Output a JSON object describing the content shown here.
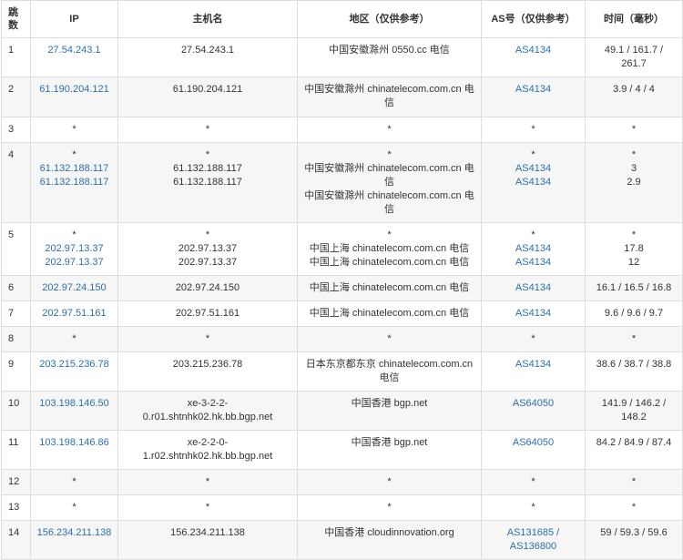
{
  "table": {
    "headers": {
      "hop": "跳数",
      "ip": "IP",
      "host": "主机名",
      "region": "地区（仅供参考）",
      "as": "AS号（仅供参考）",
      "time": "时间（毫秒）"
    },
    "rows": [
      {
        "hop": "1",
        "ip": [
          "27.54.243.1"
        ],
        "host": [
          "27.54.243.1"
        ],
        "region": [
          "中国安徽滁州 0550.cc 电信"
        ],
        "as": [
          "AS4134"
        ],
        "time": [
          "49.1 / 161.7 /",
          "261.7"
        ]
      },
      {
        "hop": "2",
        "ip": [
          "61.190.204.121"
        ],
        "host": [
          "61.190.204.121"
        ],
        "region": [
          "中国安徽滁州 chinatelecom.com.cn 电",
          "信"
        ],
        "as": [
          "AS4134"
        ],
        "time": [
          "3.9 / 4 / 4"
        ]
      },
      {
        "hop": "3",
        "ip": [
          "*"
        ],
        "host": [
          "*"
        ],
        "region": [
          "*"
        ],
        "as": [
          "*"
        ],
        "time": [
          "*"
        ]
      },
      {
        "hop": "4",
        "ip": [
          "*",
          "61.132.188.117",
          "61.132.188.117"
        ],
        "host": [
          "*",
          "61.132.188.117",
          "61.132.188.117"
        ],
        "region": [
          "*",
          "中国安徽滁州 chinatelecom.com.cn 电",
          "信",
          "中国安徽滁州 chinatelecom.com.cn 电",
          "信"
        ],
        "as": [
          "*",
          "AS4134",
          "AS4134"
        ],
        "time": [
          "*",
          "3",
          "2.9"
        ]
      },
      {
        "hop": "5",
        "ip": [
          "*",
          "202.97.13.37",
          "202.97.13.37"
        ],
        "host": [
          "*",
          "202.97.13.37",
          "202.97.13.37"
        ],
        "region": [
          "*",
          "中国上海 chinatelecom.com.cn 电信",
          "中国上海 chinatelecom.com.cn 电信"
        ],
        "as": [
          "*",
          "AS4134",
          "AS4134"
        ],
        "time": [
          "*",
          "17.8",
          "12"
        ]
      },
      {
        "hop": "6",
        "ip": [
          "202.97.24.150"
        ],
        "host": [
          "202.97.24.150"
        ],
        "region": [
          "中国上海 chinatelecom.com.cn 电信"
        ],
        "as": [
          "AS4134"
        ],
        "time": [
          "16.1 / 16.5 / 16.8"
        ]
      },
      {
        "hop": "7",
        "ip": [
          "202.97.51.161"
        ],
        "host": [
          "202.97.51.161"
        ],
        "region": [
          "中国上海 chinatelecom.com.cn 电信"
        ],
        "as": [
          "AS4134"
        ],
        "time": [
          "9.6 / 9.6 / 9.7"
        ]
      },
      {
        "hop": "8",
        "ip": [
          "*"
        ],
        "host": [
          "*"
        ],
        "region": [
          "*"
        ],
        "as": [
          "*"
        ],
        "time": [
          "*"
        ]
      },
      {
        "hop": "9",
        "ip": [
          "203.215.236.78"
        ],
        "host": [
          "203.215.236.78"
        ],
        "region": [
          "日本东京都东京 chinatelecom.com.cn",
          "电信"
        ],
        "as": [
          "AS4134"
        ],
        "time": [
          "38.6 / 38.7 / 38.8"
        ]
      },
      {
        "hop": "10",
        "ip": [
          "103.198.146.50"
        ],
        "host": [
          "xe-3-2-2-",
          "0.r01.shtnhk02.hk.bb.bgp.net"
        ],
        "region": [
          "中国香港 bgp.net"
        ],
        "as": [
          "AS64050"
        ],
        "time": [
          "141.9 / 146.2 /",
          "148.2"
        ]
      },
      {
        "hop": "11",
        "ip": [
          "103.198.146.86"
        ],
        "host": [
          "xe-2-2-0-",
          "1.r02.shtnhk02.hk.bb.bgp.net"
        ],
        "region": [
          "中国香港 bgp.net"
        ],
        "as": [
          "AS64050"
        ],
        "time": [
          "84.2 / 84.9 / 87.4"
        ]
      },
      {
        "hop": "12",
        "ip": [
          "*"
        ],
        "host": [
          "*"
        ],
        "region": [
          "*"
        ],
        "as": [
          "*"
        ],
        "time": [
          "*"
        ]
      },
      {
        "hop": "13",
        "ip": [
          "*"
        ],
        "host": [
          "*"
        ],
        "region": [
          "*"
        ],
        "as": [
          "*"
        ],
        "time": [
          "*"
        ]
      },
      {
        "hop": "14",
        "ip": [
          "156.234.211.138"
        ],
        "host": [
          "156.234.211.138"
        ],
        "region": [
          "中国香港 cloudinnovation.org"
        ],
        "as": [
          "AS131685 /",
          "AS136800"
        ],
        "time": [
          "59 / 59.3 / 59.6"
        ]
      }
    ]
  },
  "colors": {
    "link": "#2a6fb0",
    "border": "#dddddd",
    "row_alt": "#f6f6f6"
  }
}
